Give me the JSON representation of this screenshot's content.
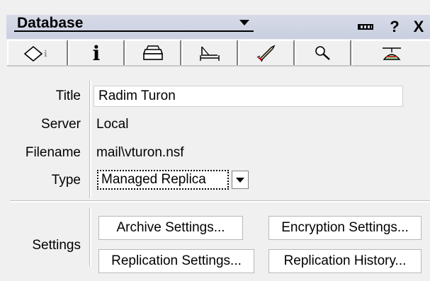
{
  "header": {
    "database_label": "Database",
    "help_label": "?",
    "close_label": "X"
  },
  "tabs": [
    {
      "name": "basics",
      "icon": "book-icon"
    },
    {
      "name": "info",
      "icon": "info-icon",
      "label": "i"
    },
    {
      "name": "print",
      "icon": "printer-icon"
    },
    {
      "name": "design",
      "icon": "triangle-ruler-icon"
    },
    {
      "name": "launch",
      "icon": "rocket-icon"
    },
    {
      "name": "full-text",
      "icon": "magnifier-icon"
    },
    {
      "name": "advanced",
      "icon": "propeller-hat-icon"
    }
  ],
  "fields": {
    "title_label": "Title",
    "title_value": "Radim Turon",
    "server_label": "Server",
    "server_value": "Local",
    "filename_label": "Filename",
    "filename_value": "mail\\vturon.nsf",
    "type_label": "Type",
    "type_value": "Managed Replica"
  },
  "settings": {
    "label": "Settings",
    "archive_button": "Archive Settings...",
    "encryption_button": "Encryption Settings...",
    "replication_button": "Replication Settings...",
    "history_button": "Replication History..."
  }
}
